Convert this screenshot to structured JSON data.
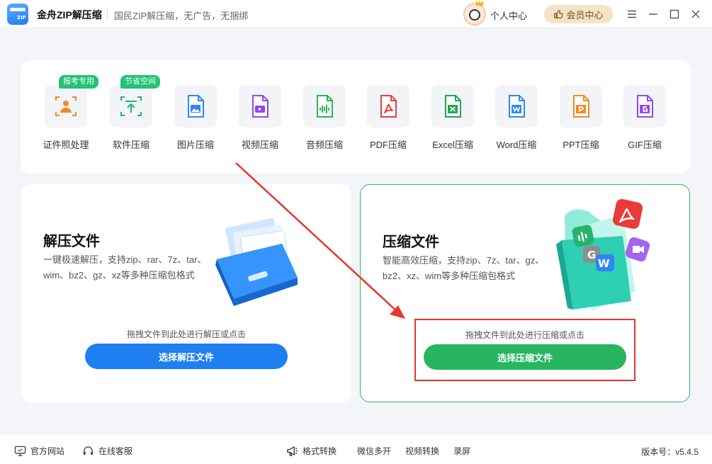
{
  "app": {
    "name": "金舟ZIP解压缩",
    "logo_text": "ZIP",
    "slogan": "国民ZIP解压缩，无广告，无捆绑",
    "personal_center": "个人中心",
    "vip_center": "会员中心"
  },
  "tools": [
    {
      "label": "证件照处理",
      "badge": "报考专用",
      "icon": "id-photo-icon",
      "color": "#f08a24"
    },
    {
      "label": "软件压缩",
      "badge": "节省空间",
      "icon": "software-compress-icon",
      "color": "#23b56c"
    },
    {
      "label": "图片压缩",
      "badge": "",
      "icon": "image-file-icon",
      "color": "#2f86f2"
    },
    {
      "label": "视频压缩",
      "badge": "",
      "icon": "video-file-icon",
      "color": "#8f4ae6"
    },
    {
      "label": "音频压缩",
      "badge": "",
      "icon": "audio-file-icon",
      "color": "#2bb556"
    },
    {
      "label": "PDF压缩",
      "badge": "",
      "icon": "pdf-file-icon",
      "color": "#ec3d3d"
    },
    {
      "label": "Excel压缩",
      "badge": "",
      "icon": "excel-file-icon",
      "color": "#22a551"
    },
    {
      "label": "Word压缩",
      "badge": "",
      "icon": "word-file-icon",
      "color": "#2f86f2"
    },
    {
      "label": "PPT压缩",
      "badge": "",
      "icon": "ppt-file-icon",
      "color": "#f08a24"
    },
    {
      "label": "GIF压缩",
      "badge": "",
      "icon": "gif-file-icon",
      "color": "#8f4ae6"
    }
  ],
  "decompress": {
    "title": "解压文件",
    "desc": "一键极速解压，支持zip、rar、7z、tar、wim、bz2、gz、xz等多种压缩包格式",
    "hint": "拖拽文件到此处进行解压或点击",
    "button": "选择解压文件"
  },
  "compress": {
    "title": "压缩文件",
    "desc": "智能高效压缩，支持zip、7z、tar、gz、bz2、xz、wim等多种压缩包格式",
    "hint": "拖拽文件到此处进行压缩或点击",
    "button": "选择压缩文件"
  },
  "footer": {
    "website": "官方网站",
    "support": "在线客服",
    "format_convert": "格式转换",
    "wechat_multi": "微信多开",
    "video_convert": "视频转换",
    "record": "录屏",
    "version": "版本号：v5.4.5"
  },
  "colors": {
    "primary_blue": "#1f7ff0",
    "primary_green": "#27b560",
    "badge_green": "#23c276",
    "annotation_red": "#e5362c"
  }
}
